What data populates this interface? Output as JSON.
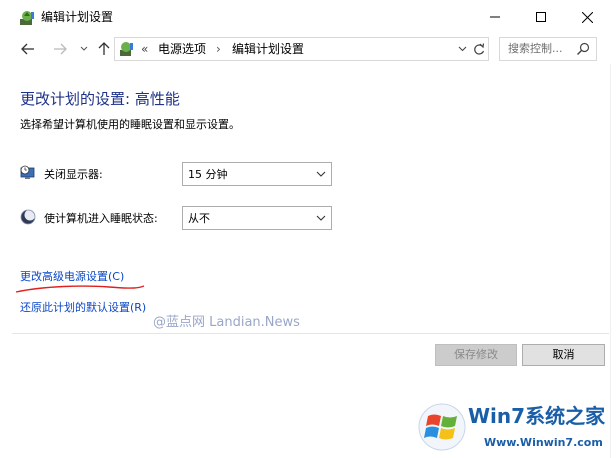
{
  "window": {
    "title": "编辑计划设置"
  },
  "nav": {
    "address_chevron": "«",
    "breadcrumb": [
      "电源选项",
      "编辑计划设置"
    ],
    "breadcrumb_separator": "›",
    "search_placeholder": "搜索控制..."
  },
  "content": {
    "heading": "更改计划的设置: 高性能",
    "subheading": "选择希望计算机使用的睡眠设置和显示设置。",
    "settings": [
      {
        "label": "关闭显示器:",
        "value": "15 分钟",
        "icon": "monitor-clock-icon"
      },
      {
        "label": "使计算机进入睡眠状态:",
        "value": "从不",
        "icon": "moon-sleep-icon"
      }
    ],
    "links": {
      "advanced": "更改高级电源设置(C)",
      "restore": "还原此计划的默认设置(R)"
    },
    "watermark": "@蓝点网 Landian.News"
  },
  "buttons": {
    "save": "保存修改",
    "cancel": "取消"
  },
  "badge": {
    "title": "Win7系统之家",
    "url": "Www.Winwin7.com"
  },
  "colors": {
    "heading": "#1e3287",
    "link": "#0a47c5",
    "annotation_red": "#e02020",
    "badge_blue": "#1a5ea8"
  }
}
